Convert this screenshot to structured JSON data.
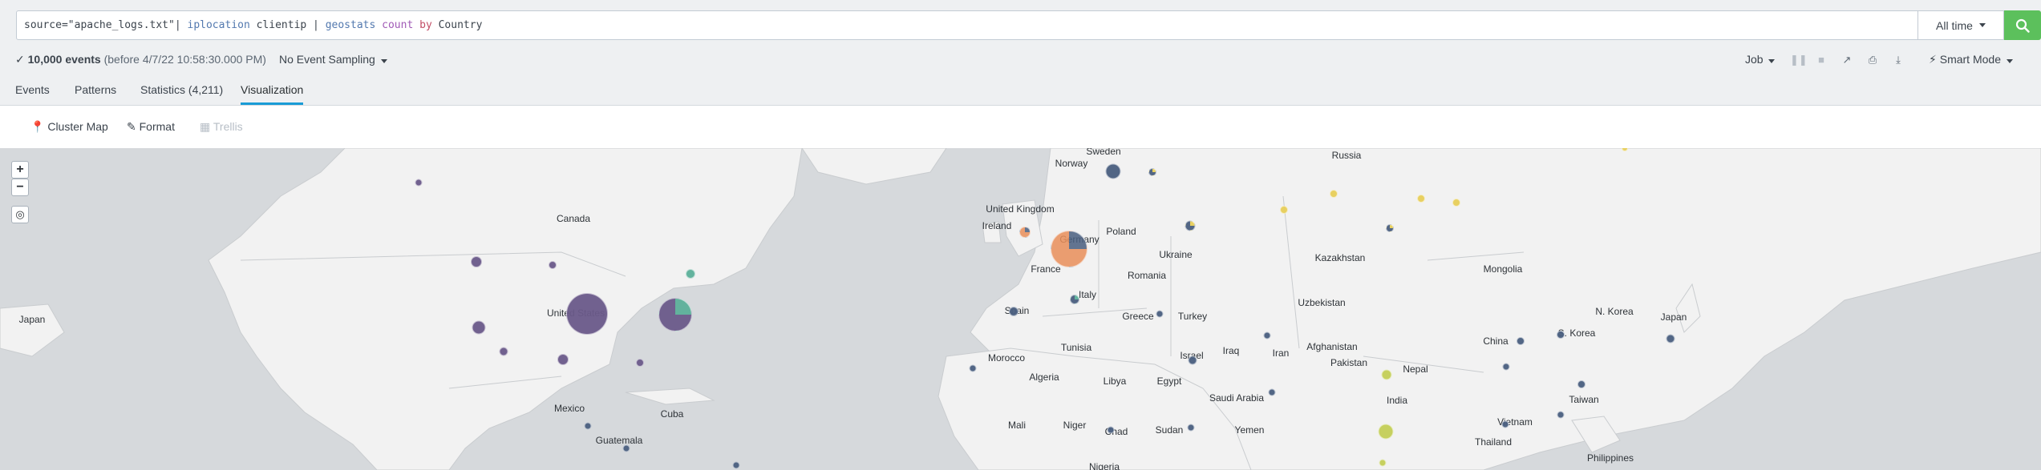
{
  "search": {
    "query_parts": [
      {
        "text": "source=\"apache_logs.txt\"| ",
        "cls": "q-arg"
      },
      {
        "text": "iplocation",
        "cls": "q-cmd"
      },
      {
        "text": " clientip | ",
        "cls": "q-arg"
      },
      {
        "text": "geostats",
        "cls": "q-cmd"
      },
      {
        "text": " ",
        "cls": "q-arg"
      },
      {
        "text": "count",
        "cls": "q-fn"
      },
      {
        "text": " ",
        "cls": "q-arg"
      },
      {
        "text": "by",
        "cls": "q-kw"
      },
      {
        "text": " Country",
        "cls": "q-arg"
      }
    ],
    "time_range": "All time",
    "search_icon": "search-icon"
  },
  "status": {
    "check": "✓",
    "events_count": "10,000 events",
    "events_sub": "(before 4/7/22 10:58:30.000 PM)",
    "sampling": "No Event Sampling",
    "job_label": "Job",
    "smart_mode": "Smart Mode",
    "smart_icon": "lightning-icon"
  },
  "tabs": [
    {
      "label": "Events",
      "active": false
    },
    {
      "label": "Patterns",
      "active": false
    },
    {
      "label": "Statistics (4,211)",
      "active": false
    },
    {
      "label": "Visualization",
      "active": true
    }
  ],
  "viz_toolbar": {
    "cluster_map": "Cluster Map",
    "format": "Format",
    "trellis": "Trellis"
  },
  "map": {
    "labels": [
      "Sweden",
      "Norway",
      "Russia",
      "Canada",
      "United Kingdom",
      "Ireland",
      "Poland",
      "Germany",
      "Ukraine",
      "France",
      "Kazakhstan",
      "Mongolia",
      "Romania",
      "Italy",
      "Uzbekistan",
      "Japan",
      "United States",
      "Spain",
      "Greece",
      "Turkey",
      "N. Korea",
      "Japan",
      "S. Korea",
      "China",
      "Iran",
      "Afghanistan",
      "Iraq",
      "Tunisia",
      "Morocco",
      "Israel",
      "Pakistan",
      "Nepal",
      "Algeria",
      "Libya",
      "Egypt",
      "Saudi Arabia",
      "India",
      "Mexico",
      "Cuba",
      "Taiwan",
      "Mali",
      "Niger",
      "Chad",
      "Sudan",
      "Yemen",
      "Vietnam",
      "Guatemala",
      "Thailand",
      "Philippines",
      "Nigeria"
    ],
    "colors": {
      "water": "#d6d9dc",
      "land": "#f2f2f2",
      "border": "#c9cccf",
      "purple": "#6b5a8a",
      "navy": "#4a5f80",
      "yellow": "#e8cf5a",
      "orange": "#e98f5a",
      "olive": "#c4cf58",
      "teal": "#5cb09a"
    }
  }
}
